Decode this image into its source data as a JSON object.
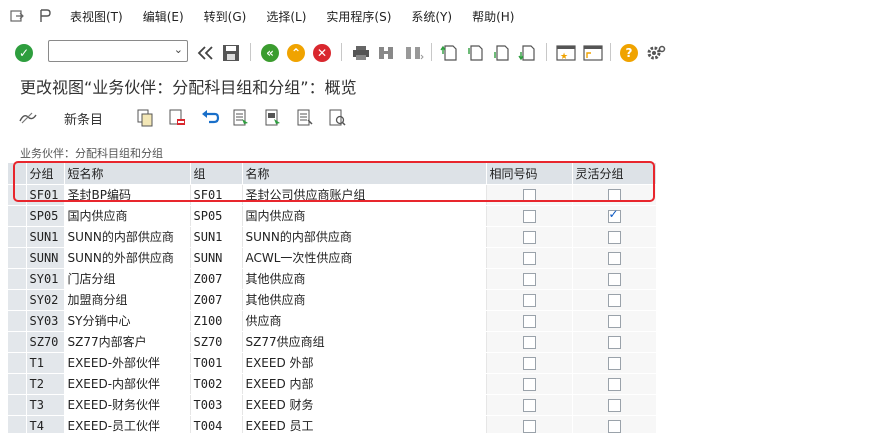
{
  "menu": {
    "items": [
      "表视图(T)",
      "编辑(E)",
      "转到(G)",
      "选择(L)",
      "实用程序(S)",
      "系统(Y)",
      "帮助(H)"
    ]
  },
  "toolbar": {
    "command_value": ""
  },
  "screen": {
    "title": "更改视图“业务伙伴：分配科目组和分组”：概览"
  },
  "app_toolbar": {
    "new_entries_label": "新条目"
  },
  "section": {
    "title": "业务伙伴：分配科目组和分组"
  },
  "table": {
    "headers": [
      "分组",
      "短名称",
      "组",
      "名称",
      "相同号码",
      "灵活分组"
    ],
    "rows": [
      {
        "grouping": "SF01",
        "short_name": "圣封BP编码",
        "group": "SF01",
        "name": "圣封公司供应商账户组",
        "same_number": false,
        "flexible": false
      },
      {
        "grouping": "SP05",
        "short_name": "国内供应商",
        "group": "SP05",
        "name": "国内供应商",
        "same_number": false,
        "flexible": true
      },
      {
        "grouping": "SUN1",
        "short_name": "SUNN的内部供应商",
        "group": "SUN1",
        "name": "SUNN的内部供应商",
        "same_number": false,
        "flexible": false
      },
      {
        "grouping": "SUNN",
        "short_name": "SUNN的外部供应商",
        "group": "SUNN",
        "name": "ACWL一次性供应商",
        "same_number": false,
        "flexible": false
      },
      {
        "grouping": "SY01",
        "short_name": "门店分组",
        "group": "Z007",
        "name": "其他供应商",
        "same_number": false,
        "flexible": false
      },
      {
        "grouping": "SY02",
        "short_name": "加盟商分组",
        "group": "Z007",
        "name": "其他供应商",
        "same_number": false,
        "flexible": false
      },
      {
        "grouping": "SY03",
        "short_name": "SY分销中心",
        "group": "Z100",
        "name": "供应商",
        "same_number": false,
        "flexible": false
      },
      {
        "grouping": "SZ70",
        "short_name": "SZ77内部客户",
        "group": "SZ70",
        "name": "SZ77供应商组",
        "same_number": false,
        "flexible": false
      },
      {
        "grouping": "T1",
        "short_name": "EXEED-外部伙伴",
        "group": "T001",
        "name": "EXEED 外部",
        "same_number": false,
        "flexible": false
      },
      {
        "grouping": "T2",
        "short_name": "EXEED-内部伙伴",
        "group": "T002",
        "name": "EXEED 内部",
        "same_number": false,
        "flexible": false
      },
      {
        "grouping": "T3",
        "short_name": "EXEED-财务伙伴",
        "group": "T003",
        "name": "EXEED 财务",
        "same_number": false,
        "flexible": false
      },
      {
        "grouping": "T4",
        "short_name": "EXEED-员工伙伴",
        "group": "T004",
        "name": "EXEED 员工",
        "same_number": false,
        "flexible": false
      }
    ]
  },
  "colors": {
    "header_bg": "#dde2e7",
    "key_bg": "#e3e7eb",
    "highlight": "#e8262d",
    "ok_green": "#2e9e3e",
    "nav_green": "#3b9c2f",
    "nav_orange": "#f0a300",
    "cancel_red": "#d9272e",
    "help_orange": "#f0a300"
  }
}
